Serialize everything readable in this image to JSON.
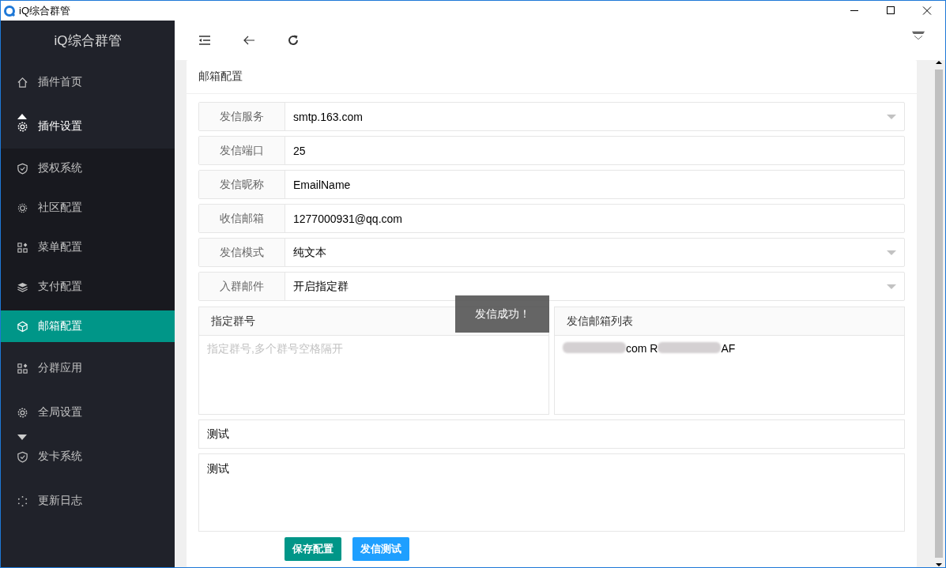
{
  "window": {
    "title": "iQ综合群管"
  },
  "sidebar": {
    "title": "iQ综合群管",
    "items": [
      {
        "label": "插件首页",
        "selected": false
      },
      {
        "label": "插件设置",
        "selected": false,
        "expanded": true,
        "children": [
          {
            "label": "授权系统",
            "selected": false
          },
          {
            "label": "社区配置",
            "selected": false
          },
          {
            "label": "菜单配置",
            "selected": false
          },
          {
            "label": "支付配置",
            "selected": false
          },
          {
            "label": "邮箱配置",
            "selected": true
          }
        ]
      },
      {
        "label": "分群应用",
        "selected": false
      },
      {
        "label": "全局设置",
        "selected": false
      },
      {
        "label": "发卡系统",
        "selected": false,
        "expanded": false
      },
      {
        "label": "更新日志",
        "selected": false
      }
    ]
  },
  "card": {
    "title": "邮箱配置"
  },
  "form_rows": [
    {
      "kind": "select",
      "label": "发信服务",
      "value": "smtp.163.com"
    },
    {
      "kind": "input",
      "label": "发信端口",
      "value": "25"
    },
    {
      "kind": "input",
      "label": "发信昵称",
      "value": "EmailName"
    },
    {
      "kind": "input",
      "label": "收信邮箱",
      "value": "1277000931@qq.com"
    },
    {
      "kind": "select",
      "label": "发信模式",
      "value": "纯文本"
    },
    {
      "kind": "select",
      "label": "入群邮件",
      "value": "开启指定群"
    }
  ],
  "panels": [
    {
      "title": "指定群号",
      "placeholder": "指定群号,多个群号空格隔开"
    },
    {
      "title": "发信邮箱列表",
      "value_parts": [
        {
          "kind": "blur"
        },
        {
          "kind": "text",
          "text": "com R"
        },
        {
          "kind": "blur"
        },
        {
          "kind": "text",
          "text": "AF"
        }
      ]
    }
  ],
  "subject": {
    "value": "测试"
  },
  "body": {
    "value": "测试"
  },
  "buttons": [
    {
      "kind": "primary",
      "label": "保存配置"
    },
    {
      "kind": "info",
      "label": "发信测试"
    }
  ],
  "toast": {
    "text": "发信成功！"
  }
}
